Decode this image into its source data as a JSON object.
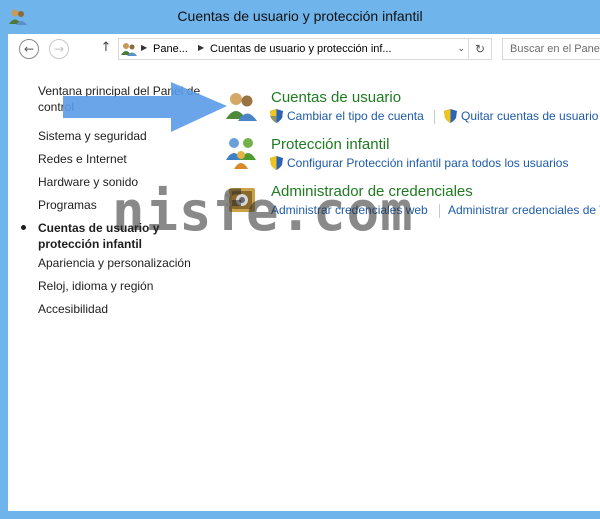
{
  "window": {
    "title": "Cuentas de usuario y protección infantil",
    "frame_color": "#6fb4ea",
    "icon": "users-icon"
  },
  "navbar": {
    "back_icon": "back-arrow-icon",
    "forward_icon": "forward-arrow-icon",
    "up_icon": "up-arrow-icon",
    "back_glyph": "←",
    "forward_glyph": "→",
    "up_glyph": "↑",
    "breadcrumb": [
      "Pane...",
      "Cuentas de usuario y protección inf..."
    ],
    "separator_glyph": "▶",
    "dropdown_glyph": "⌄",
    "refresh_glyph": "↻",
    "search_placeholder": "Buscar en el Panel"
  },
  "sidenav": {
    "items": [
      {
        "label": "Ventana principal del Panel de",
        "label2": "control"
      },
      {
        "label": "Sistema y seguridad"
      },
      {
        "label": "Redes e Internet"
      },
      {
        "label": "Hardware y sonido"
      },
      {
        "label": "Programas"
      },
      {
        "label": "Cuentas de usuario y",
        "label2": "protección infantil",
        "current": true
      },
      {
        "label": "Apariencia y personalización"
      },
      {
        "label": "Reloj, idioma y región"
      },
      {
        "label": "Accesibilidad"
      }
    ]
  },
  "categories": [
    {
      "title": "Cuentas de usuario",
      "icon": "user-accounts-icon",
      "links": [
        "Cambiar el tipo de cuenta",
        "Quitar cuentas de usuario"
      ]
    },
    {
      "title": "Protección infantil",
      "icon": "family-safety-icon",
      "links": [
        "Configurar Protección infantil para todos los usuarios"
      ]
    },
    {
      "title": "Administrador de credenciales",
      "icon": "credential-manager-icon",
      "links": [
        "Administrar credenciales web",
        "Administrar credenciales de W"
      ]
    }
  ],
  "overlay": {
    "watermark": "nisfe.com",
    "arrow_color": "#5a9be8"
  },
  "colors": {
    "category_title": "#1f7a22",
    "link": "#1e5aa8"
  }
}
